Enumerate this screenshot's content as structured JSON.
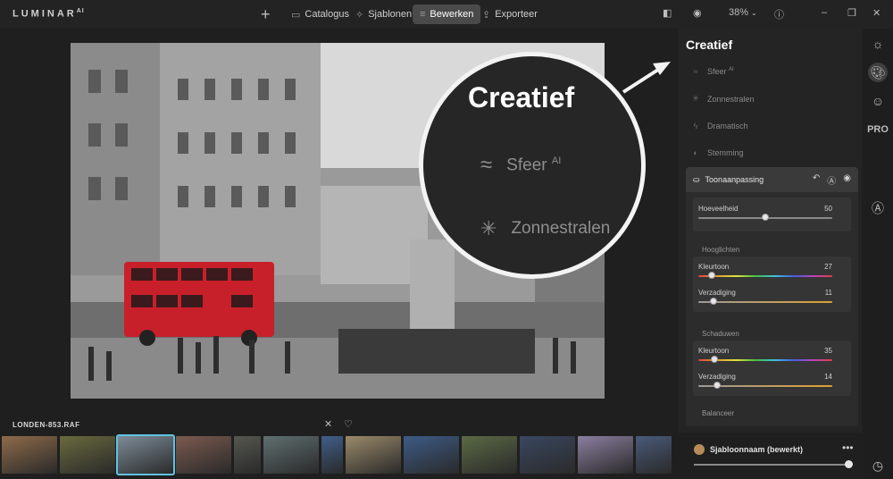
{
  "app": {
    "logo": "LUMINAR",
    "logo_sup": "AI"
  },
  "nav": [
    {
      "label": "Catalogus",
      "icon": "folder-icon"
    },
    {
      "label": "Sjablonen",
      "icon": "sparkle-icon"
    },
    {
      "label": "Bewerken",
      "icon": "sliders-icon"
    },
    {
      "label": "Exporteer",
      "icon": "export-icon"
    }
  ],
  "topright": {
    "zoom": "38%"
  },
  "panel": {
    "title": "Creatief",
    "tools": [
      {
        "label": "Sfeer",
        "sup": "AI",
        "icon": "wave-icon"
      },
      {
        "label": "Zonnestralen",
        "icon": "sun-icon"
      },
      {
        "label": "Dramatisch",
        "icon": "lightning-icon"
      },
      {
        "label": "Stemming",
        "icon": "mood-icon"
      }
    ],
    "adjust": {
      "title": "Toonaanpassing",
      "amount_label": "Hoeveelheid",
      "amount_value": "50",
      "highlights": "Hooglichten",
      "hl_hue_label": "Kleurtoon",
      "hl_hue_value": "27",
      "hl_sat_label": "Verzadiging",
      "hl_sat_value": "11",
      "shadows": "Schaduwen",
      "sh_hue_label": "Kleurtoon",
      "sh_hue_value": "35",
      "sh_sat_label": "Verzadiging",
      "sh_sat_value": "14",
      "balance": "Balanceer"
    }
  },
  "sliders": {
    "amount": 0.5,
    "hl_hue": 0.1,
    "hl_sat": 0.11,
    "sh_hue": 0.12,
    "sh_sat": 0.14
  },
  "film": {
    "filename": "LONDEN-853.RAF",
    "thumb_colors": [
      "#8f6b4a",
      "#6a6a3e",
      "#7d8c98",
      "#7b5a4f",
      "#55584e",
      "#5f6f70",
      "#3f5f8a",
      "#9a8a6a",
      "#3d5b86",
      "#5b6a45",
      "#3a4760",
      "#8c7fa0",
      "#4a5a7a"
    ]
  },
  "preset": {
    "name": "Sjabloonnaam (bewerkt)",
    "level": 1.0
  },
  "magnifier": {
    "title": "Creatief",
    "row1": "Sfeer",
    "row1_sup": "AI",
    "row2": "Zonnestralen"
  }
}
